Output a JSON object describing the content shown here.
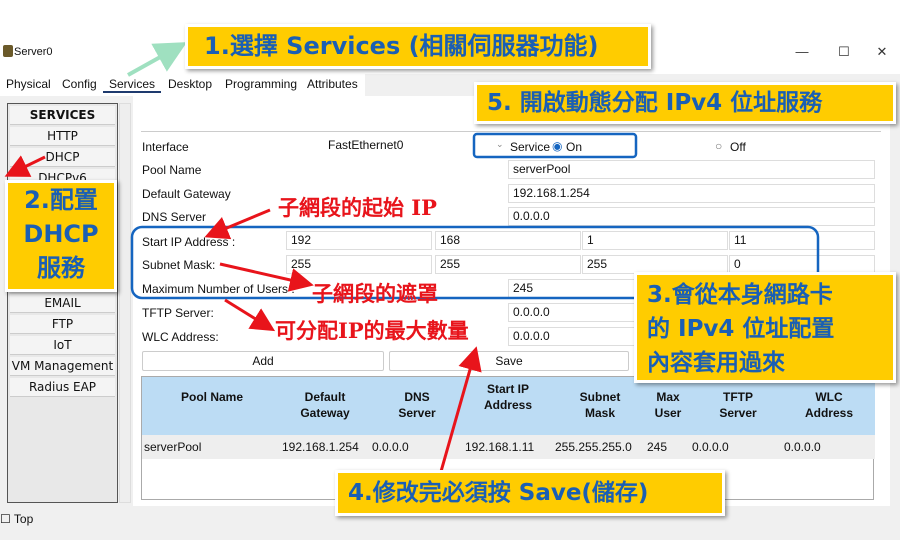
{
  "window": {
    "title": "Server0",
    "minimize": "—",
    "maximize": "☐",
    "close": "✕"
  },
  "tabs": [
    "Physical",
    "Config",
    "Services",
    "Desktop",
    "Programming",
    "Attributes"
  ],
  "sidebar": {
    "header": "SERVICES",
    "items_top": [
      "HTTP",
      "DHCP",
      "DHCPv6"
    ],
    "items_bottom": [
      "EMAIL",
      "FTP",
      "IoT",
      "VM Management",
      "Radius EAP"
    ]
  },
  "form": {
    "interface_label": "Interface",
    "interface_value": "FastEthernet0",
    "service_label": "Service",
    "on_label": "On",
    "off_label": "Off",
    "service_state": "on",
    "pool_name_label": "Pool Name",
    "pool_name": "serverPool",
    "gateway_label": "Default Gateway",
    "gateway": "192.168.1.254",
    "dns_label": "DNS Server",
    "dns": "0.0.0.0",
    "start_ip_label": "Start IP Address :",
    "start_ip": [
      "192",
      "168",
      "1",
      "11"
    ],
    "mask_label": "Subnet Mask:",
    "mask": [
      "255",
      "255",
      "255",
      "0"
    ],
    "max_users_label": "Maximum Number of Users :",
    "max_users": "245",
    "tftp_label": "TFTP Server:",
    "tftp": "0.0.0.0",
    "wlc_label": "WLC Address:",
    "wlc": "0.0.0.0",
    "add_label": "Add",
    "save_label": "Save"
  },
  "table": {
    "headers": [
      "Pool Name",
      "Default Gateway",
      "DNS Server",
      "Start IP Address",
      "Subnet Mask",
      "Max User",
      "TFTP Server",
      "WLC Address"
    ],
    "rows": [
      [
        "serverPool",
        "192.168.1.254",
        "0.0.0.0",
        "192.168.1.11",
        "255.255.255.0",
        "245",
        "0.0.0.0",
        "0.0.0.0"
      ]
    ]
  },
  "footer": {
    "top_label": "Top"
  },
  "annotations": {
    "c1": "1.選擇 Services (相關伺服器功能)",
    "c2a": "2.配置",
    "c2b": "DHCP",
    "c2c": "服務",
    "c3a": "3.會從本身網路卡",
    "c3b": "的 IPv4 位址配置",
    "c3c": "內容套用過來",
    "c4": "4.修改完必須按 Save(儲存)",
    "c5": "5. 開啟動態分配 IPv4 位址服務",
    "r1": "子網段的起始 IP",
    "r2": "子網段的遮罩",
    "r3": "可分配IP的最大數量"
  },
  "colors": {
    "callout_bg": "#ffcc00",
    "callout_text": "#1a5fb4",
    "annotation_red": "#e8141b",
    "highlight_blue": "#1565c0",
    "table_header": "#bcdcf4"
  }
}
